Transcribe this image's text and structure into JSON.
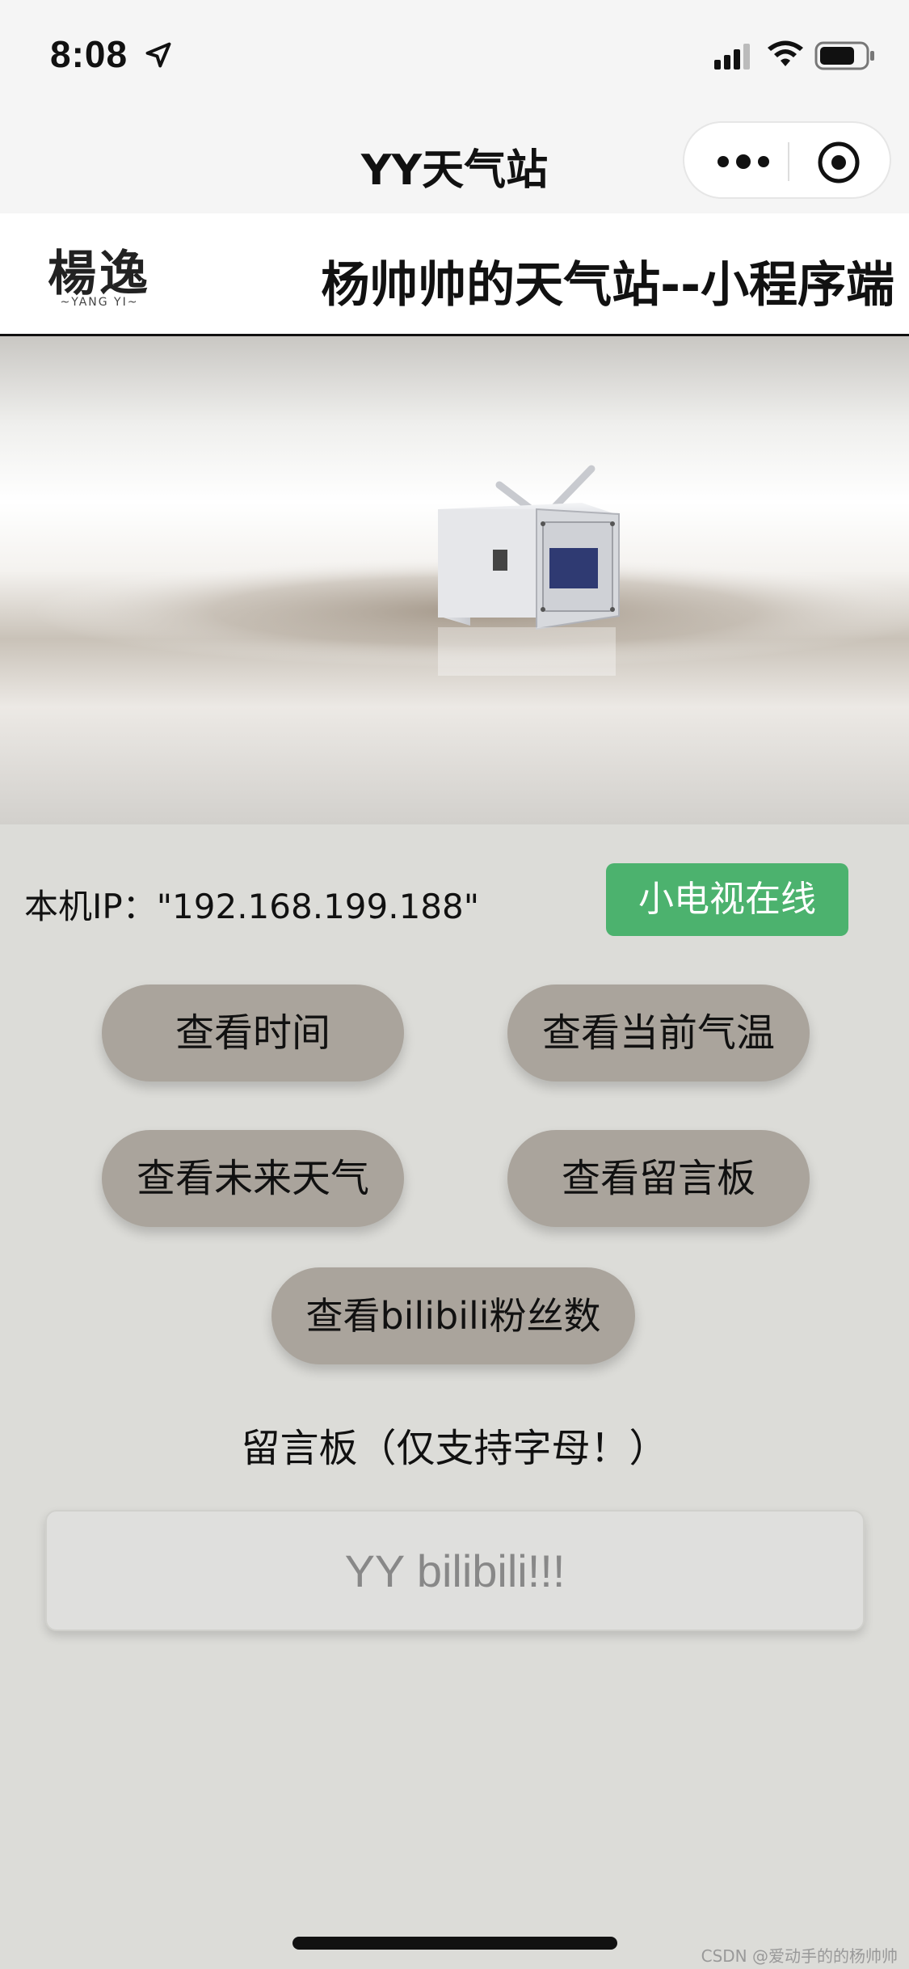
{
  "status_bar": {
    "time": "8:08",
    "icons": [
      "location-arrow-icon",
      "cellular-signal-icon",
      "wifi-icon",
      "battery-icon"
    ]
  },
  "nav_bar": {
    "title": "YY天气站",
    "capsule_icons": [
      "more-dots-icon",
      "close-target-icon"
    ]
  },
  "header": {
    "logo_text": "楊逸",
    "logo_sub": "~YANG YI~",
    "title": "杨帅帅的天气站--小程序端"
  },
  "main": {
    "ip_label": "本机IP：\"192.168.199.188\"",
    "online_badge": "小电视在线",
    "buttons": {
      "view_time": "查看时间",
      "view_temperature": "查看当前气温",
      "view_future_weather": "查看未来天气",
      "view_message_board": "查看留言板",
      "view_bilibili_fans": "查看bilibili粉丝数"
    },
    "message_board_label": "留言板（仅支持字母！）",
    "message_input_placeholder": "YY bilibili!!!"
  },
  "watermark": "CSDN @爱动手的的杨帅帅",
  "colors": {
    "online_badge": "#4cb26e",
    "button_bg": "#aaa49c",
    "page_bg": "#dcdcd8"
  }
}
